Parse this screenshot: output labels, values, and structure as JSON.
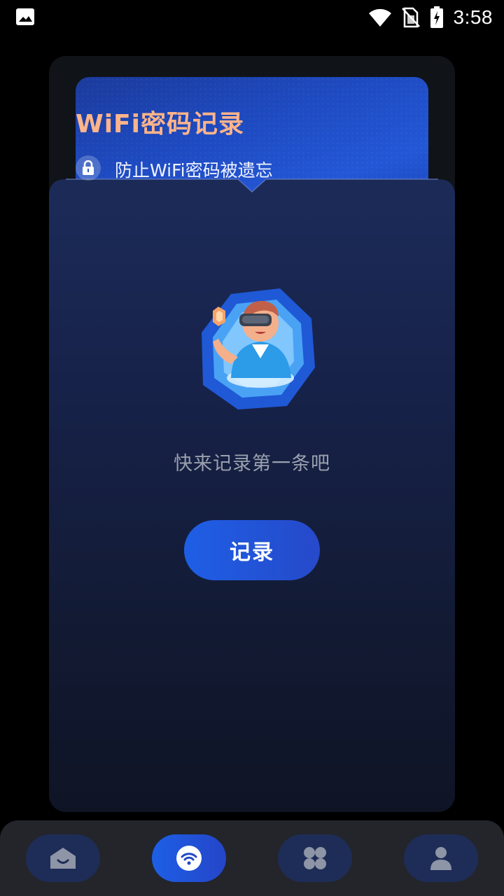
{
  "status_bar": {
    "time": "3:58",
    "icons": [
      "gallery-icon",
      "wifi-icon",
      "no-sim-icon",
      "battery-charging-icon"
    ]
  },
  "banner": {
    "title": "WiFi密码记录",
    "subtitle": "防止WiFi密码被遗忘",
    "lock_icon": "lock-icon"
  },
  "empty_state": {
    "illustration": "vr-person-illustration",
    "message": "快来记录第一条吧",
    "button_label": "记录"
  },
  "bottom_nav": {
    "items": [
      {
        "icon": "home-icon",
        "active": false
      },
      {
        "icon": "wifi-icon",
        "active": true
      },
      {
        "icon": "apps-icon",
        "active": false
      },
      {
        "icon": "profile-icon",
        "active": false
      }
    ]
  },
  "colors": {
    "accent": "#1e5fe6",
    "title_orange": "#ffb48a",
    "nav_inactive": "#1e2d57",
    "background": "#000000"
  }
}
